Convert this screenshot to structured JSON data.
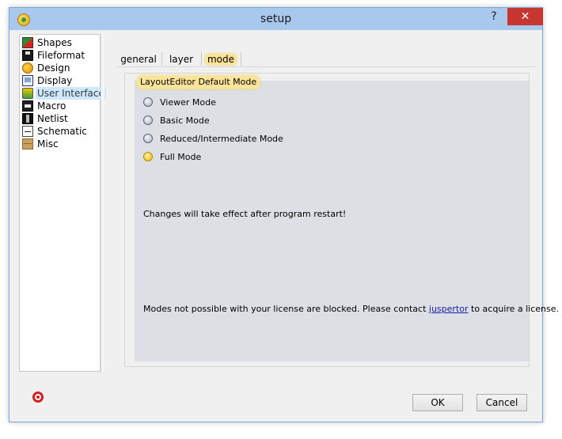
{
  "window": {
    "title": "setup",
    "help_glyph": "?",
    "close_glyph": "✕"
  },
  "sidebar": {
    "items": [
      {
        "label": "Shapes",
        "icon": "shapes-icon"
      },
      {
        "label": "Fileformat",
        "icon": "fileformat-icon"
      },
      {
        "label": "Design",
        "icon": "design-icon"
      },
      {
        "label": "Display",
        "icon": "display-icon"
      },
      {
        "label": "User Interface",
        "icon": "user-interface-icon",
        "selected": true
      },
      {
        "label": "Macro",
        "icon": "macro-icon"
      },
      {
        "label": "Netlist",
        "icon": "netlist-icon"
      },
      {
        "label": "Schematic",
        "icon": "schematic-icon"
      },
      {
        "label": "Misc",
        "icon": "misc-icon"
      }
    ]
  },
  "tabs": [
    {
      "label": "general"
    },
    {
      "label": "layer"
    },
    {
      "label": "mode",
      "active": true
    }
  ],
  "mode_group": {
    "title": "LayoutEditor Default Mode",
    "options": [
      {
        "label": "Viewer Mode",
        "checked": false
      },
      {
        "label": "Basic Mode",
        "checked": false
      },
      {
        "label": "Reduced/Intermediate Mode",
        "checked": false
      },
      {
        "label": "Full Mode",
        "checked": true
      }
    ],
    "restart_note": "Changes will take effect after program restart!",
    "license_note_before": "Modes not possible with your license are blocked. Please contact",
    "license_link": "juspertor",
    "license_note_after": "to acquire a license."
  },
  "buttons": {
    "ok": "OK",
    "cancel": "Cancel"
  },
  "colors": {
    "titlebar": "#a9c8ee",
    "close": "#c7372f",
    "highlight": "#fbe498",
    "group_bg": "#dcdfe4"
  }
}
